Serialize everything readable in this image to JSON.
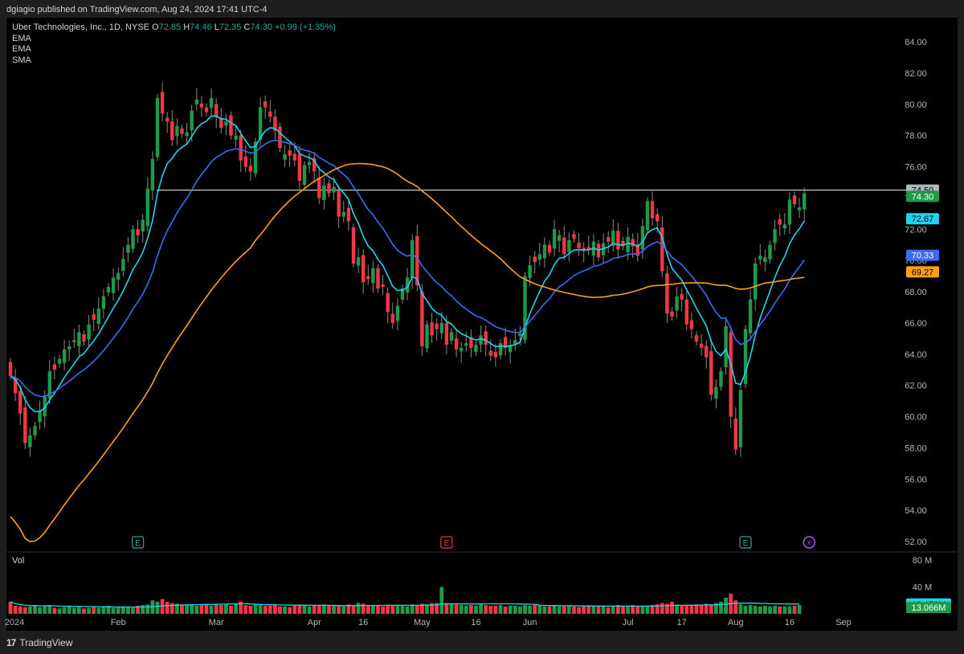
{
  "header": {
    "published": "dgiagio published on TradingView.com, Aug 24, 2024 17:41 UTC-4"
  },
  "legend": {
    "symbol": "Uber Technologies, Inc., 1D, NYSE",
    "o_label": "O",
    "o": "72.85",
    "h_label": "H",
    "h": "74.46",
    "l_label": "L",
    "l": "72.35",
    "c_label": "C",
    "c": "74.30",
    "change": "+0.99 (+1.35%)",
    "indicators": [
      "EMA",
      "EMA",
      "SMA"
    ]
  },
  "volume_pane": {
    "title": "Vol"
  },
  "footer": {
    "brand": "TradingView"
  },
  "colors": {
    "up": "#26a69a",
    "up_fill": "#1f9a4a",
    "down": "#f23645",
    "ema_fast": "#22d3ee",
    "ema_slow": "#3b6cf2",
    "sma": "#ff9f1a",
    "hline": "#c8c8c8"
  },
  "chart_data": {
    "type": "candlestick",
    "symbol": "UBER",
    "interval": "1D",
    "y_range": [
      52,
      84
    ],
    "y_ticks": [
      "84.00",
      "82.00",
      "80.00",
      "78.00",
      "76.00",
      "74.00",
      "72.00",
      "70.00",
      "68.00",
      "66.00",
      "64.00",
      "62.00",
      "60.00",
      "58.00",
      "56.00",
      "54.00",
      "52.00"
    ],
    "x_ticks": [
      {
        "label": "2024",
        "idx": 0
      },
      {
        "label": "Feb",
        "idx": 22
      },
      {
        "label": "Mar",
        "idx": 42
      },
      {
        "label": "Apr",
        "idx": 62
      },
      {
        "label": "16",
        "idx": 72
      },
      {
        "label": "May",
        "idx": 84
      },
      {
        "label": "16",
        "idx": 95
      },
      {
        "label": "Jun",
        "idx": 106
      },
      {
        "label": "Jul",
        "idx": 126
      },
      {
        "label": "17",
        "idx": 137
      },
      {
        "label": "Aug",
        "idx": 148
      },
      {
        "label": "16",
        "idx": 159
      },
      {
        "label": "Sep",
        "idx": 170
      }
    ],
    "horizontal_line": 74.5,
    "price_labels": [
      {
        "text": "74.50",
        "value": 74.5,
        "color": "#b2b5be",
        "text_color": "#000000"
      },
      {
        "text": "74.30",
        "value": 74.1,
        "color": "#1f9a4a",
        "text_color": "#ffffff"
      },
      {
        "text": "72.67",
        "value": 72.67,
        "color": "#22d3ee",
        "text_color": "#000000"
      },
      {
        "text": "70.33",
        "value": 70.33,
        "color": "#3b6cf2",
        "text_color": "#ffffff"
      },
      {
        "text": "69.27",
        "value": 69.27,
        "color": "#ff9f1a",
        "text_color": "#000000"
      }
    ],
    "volume_axis": [
      "80 M",
      "40 M"
    ],
    "volume_labels": [
      {
        "text": "18.479M",
        "color": "#22d3ee",
        "text_color": "#000000"
      },
      {
        "text": "13.066M",
        "color": "#1f9a4a",
        "text_color": "#ffffff"
      }
    ],
    "earnings_markers": [
      {
        "idx": 26,
        "label": "E",
        "type": "past-up"
      },
      {
        "idx": 89,
        "label": "E",
        "type": "past-down"
      },
      {
        "idx": 150,
        "label": "E",
        "type": "past-up"
      },
      {
        "idx": 163,
        "label": "⚡",
        "type": "event"
      }
    ],
    "closes": [
      62.6,
      61.5,
      60.2,
      58.3,
      58.8,
      59.4,
      60.4,
      61.3,
      62.9,
      63.0,
      63.7,
      64.3,
      64.5,
      64.9,
      65.4,
      64.8,
      65.9,
      66.2,
      66.9,
      67.7,
      68.3,
      68.9,
      69.2,
      70.1,
      71.0,
      72.0,
      71.6,
      72.6,
      74.6,
      76.5,
      80.4,
      79.4,
      78.9,
      77.7,
      78.6,
      78.1,
      78.2,
      79.6,
      80.3,
      79.8,
      79.5,
      80.4,
      79.2,
      78.5,
      78.9,
      78.0,
      78.0,
      76.4,
      76.0,
      75.7,
      77.6,
      79.8,
      79.8,
      79.2,
      78.3,
      77.2,
      76.8,
      76.7,
      76.4,
      75.1,
      76.1,
      76.3,
      75.7,
      74.0,
      74.8,
      74.3,
      74.7,
      72.8,
      73.1,
      72.5,
      69.8,
      70.2,
      68.6,
      68.8,
      69.5,
      68.2,
      68.3,
      66.7,
      66.0,
      67.1,
      68.2,
      68.9,
      71.3,
      68.4,
      64.5,
      65.9,
      65.2,
      65.6,
      66.0,
      64.6,
      65.4,
      64.3,
      64.4,
      64.7,
      64.4,
      64.6,
      65.2,
      64.6,
      63.9,
      63.8,
      64.7,
      64.4,
      64.6,
      64.9,
      65.3,
      69.0,
      69.7,
      69.9,
      70.4,
      71.0,
      70.5,
      72.0,
      71.6,
      70.4,
      71.3,
      71.4,
      70.8,
      70.6,
      70.7,
      71.2,
      70.2,
      71.1,
      71.2,
      71.9,
      70.7,
      70.9,
      71.5,
      70.9,
      70.3,
      72.2,
      73.8,
      72.7,
      72.5,
      69.3,
      66.6,
      66.4,
      67.7,
      67.5,
      65.9,
      65.6,
      64.8,
      64.4,
      63.8,
      61.4,
      61.9,
      62.9,
      65.8,
      60.0,
      57.9,
      61.7,
      65.6,
      67.5,
      69.8,
      70.3,
      70.2,
      71.0,
      72.0,
      72.3,
      72.3,
      73.9,
      73.6,
      73.4,
      74.3
    ],
    "volumes": [
      18,
      12,
      11,
      10,
      11,
      12,
      10,
      12,
      13,
      9,
      8,
      10,
      11,
      9,
      10,
      8,
      9,
      10,
      9,
      11,
      12,
      9,
      10,
      11,
      10,
      9,
      12,
      13,
      14,
      20,
      18,
      22,
      18,
      16,
      15,
      14,
      13,
      14,
      12,
      13,
      14,
      12,
      14,
      13,
      14,
      12,
      15,
      18,
      13,
      12,
      14,
      13,
      12,
      12,
      13,
      11,
      11,
      10,
      12,
      13,
      12,
      11,
      13,
      12,
      14,
      12,
      12,
      13,
      11,
      14,
      12,
      16,
      15,
      12,
      13,
      12,
      11,
      12,
      12,
      13,
      12,
      11,
      14,
      13,
      15,
      14,
      16,
      16,
      40,
      16,
      15,
      14,
      13,
      12,
      13,
      12,
      14,
      13,
      12,
      12,
      13,
      11,
      12,
      12,
      11,
      13,
      12,
      14,
      12,
      11,
      11,
      12,
      11,
      11,
      12,
      11,
      10,
      11,
      12,
      11,
      12,
      11,
      10,
      12,
      13,
      11,
      12,
      13,
      12,
      11,
      12,
      13,
      14,
      16,
      15,
      18,
      14,
      12,
      13,
      12,
      14,
      13,
      15,
      14,
      16,
      18,
      24,
      30,
      20,
      14,
      12,
      13,
      12,
      11,
      12,
      11,
      12,
      11,
      11,
      11,
      12,
      13
    ],
    "series": [
      {
        "name": "EMA",
        "color": "#22d3ee"
      },
      {
        "name": "EMA",
        "color": "#3b6cf2"
      },
      {
        "name": "SMA",
        "color": "#ff9f1a"
      }
    ]
  }
}
